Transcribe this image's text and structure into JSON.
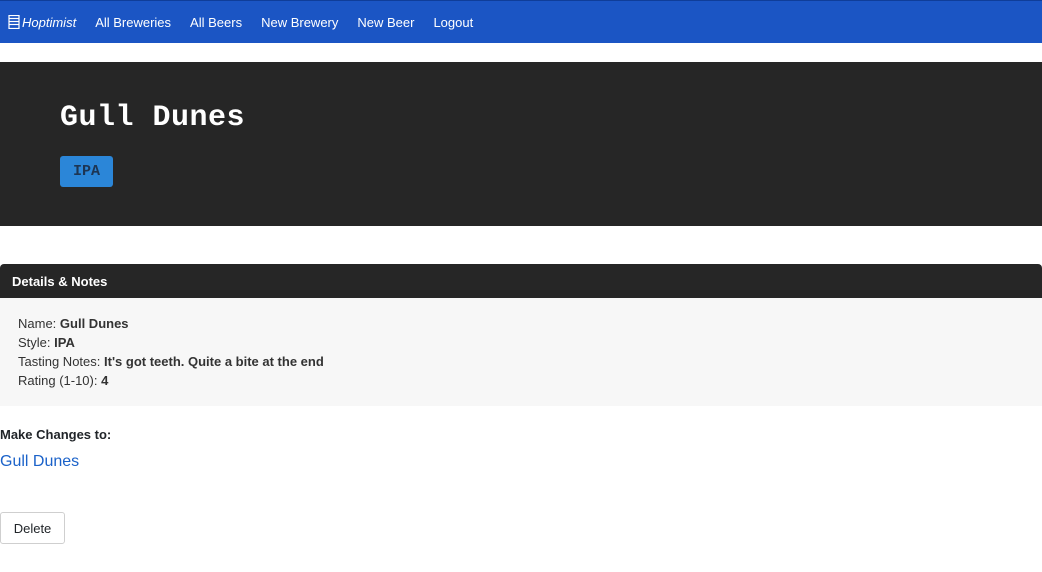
{
  "navbar": {
    "brand": "Hoptimist",
    "brand_icon": "beer-glass-icon",
    "links": [
      "All Breweries",
      "All Beers",
      "New Brewery",
      "New Beer",
      "Logout"
    ],
    "color": "#1b55c4"
  },
  "hero": {
    "title": "Gull Dunes",
    "badge": "IPA",
    "badge_color": "#2b86d8"
  },
  "details": {
    "header": "Details & Notes",
    "name_label": "Name:",
    "name_value": "Gull Dunes",
    "style_label": "Style:",
    "style_value": "IPA",
    "notes_label": "Tasting Notes:",
    "notes_value": "It's got teeth. Quite a bite at the end",
    "rating_label": "Rating (1-10):",
    "rating_value": "4"
  },
  "actions": {
    "make_changes": "Make Changes to:",
    "edit_link": "Gull Dunes",
    "delete_label": "Delete"
  }
}
